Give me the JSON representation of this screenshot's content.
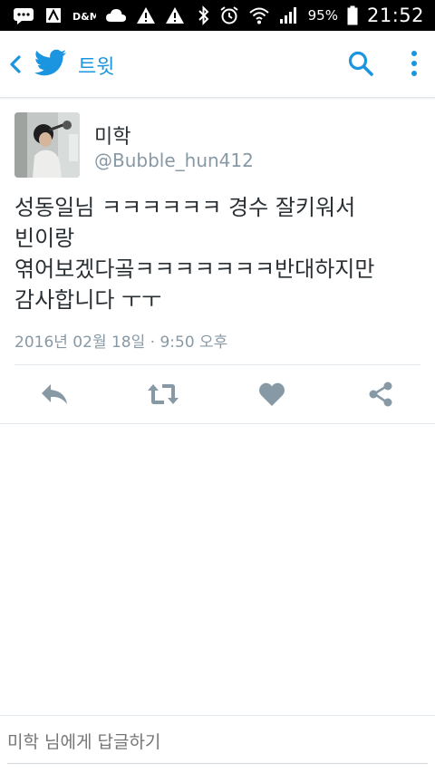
{
  "status_bar": {
    "battery_percent": "95%",
    "time": "21:52"
  },
  "app_bar": {
    "title": "트윗",
    "accent_color": "#1b95e0"
  },
  "tweet": {
    "display_name": "미학",
    "handle": "@Bubble_hun412",
    "text": "성동일님 ㅋㅋㅋㅋㅋㅋ 경수 잘키워서\n빈이랑\n엮어보겠다곸ㅋㅋㅋㅋㅋㅋㅋ반대하지만\n감사합니다 ㅜㅜ",
    "meta": "2016년 02월 18일 · 9:50 오후"
  },
  "actions": {
    "icons": [
      "reply-icon",
      "retweet-icon",
      "like-icon",
      "share-icon"
    ],
    "icon_color": "#8899a6"
  },
  "reply": {
    "placeholder": "미학 님에게 답글하기"
  }
}
